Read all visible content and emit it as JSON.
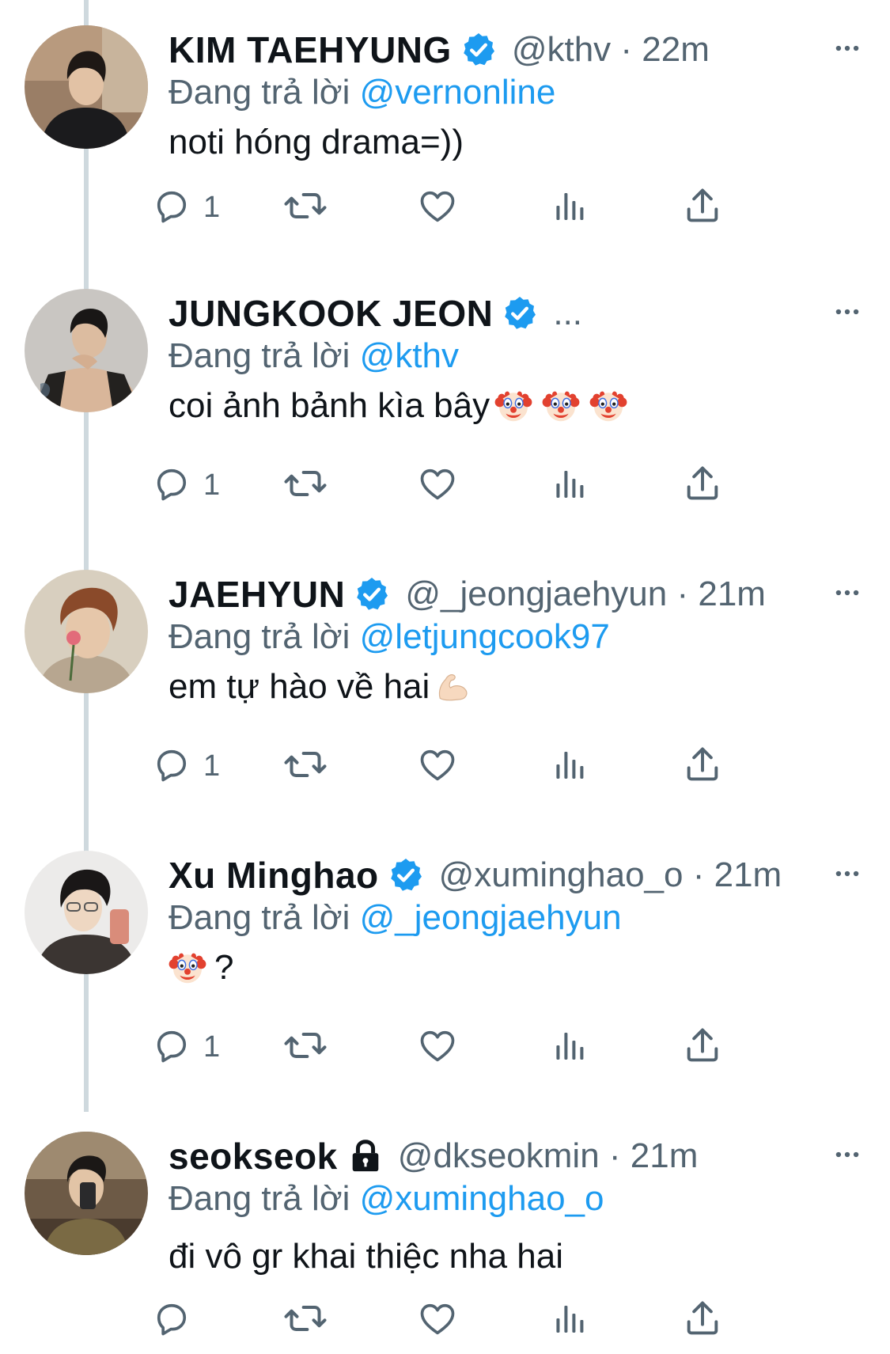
{
  "reply_prefix": "Đang trả lời",
  "icons": {
    "reply": "speech-bubble-icon",
    "retweet": "retweet-arrows-icon",
    "like": "heart-icon",
    "views": "bar-chart-icon",
    "share": "share-upload-icon",
    "more": "ellipsis-icon",
    "verified": "verified-badge-icon",
    "protected": "lock-icon"
  },
  "colors": {
    "verified": "#1d9bf0",
    "mention": "#1d9bf0",
    "secondary_text": "#536471"
  },
  "tweets": [
    {
      "name": "KIM TAEHYUNG",
      "handle_time": "@kthv · 22m",
      "reply_to": "@vernonline",
      "text": "noti hóng drama=))",
      "reply_count": "1"
    },
    {
      "name": "JUNGKOOK JEON",
      "handle_time": "...",
      "reply_to": "@kthv",
      "text": "coi ảnh bảnh kìa bây",
      "reply_count": "1"
    },
    {
      "name": "JAEHYUN",
      "handle_time": "@_jeongjaehyun · 21m",
      "reply_to": "@letjungcook97",
      "text": "em tự hào về hai",
      "reply_count": "1"
    },
    {
      "name": "Xu Minghao",
      "handle_time": "@xuminghao_o · 21m",
      "reply_to": "@_jeongjaehyun",
      "text": "?",
      "reply_count": "1"
    },
    {
      "name": "seokseok",
      "handle_time": "@dkseokmin · 21m",
      "reply_to": "@xuminghao_o",
      "text": "đi vô gr khai thiệc nha hai",
      "reply_count": ""
    }
  ]
}
